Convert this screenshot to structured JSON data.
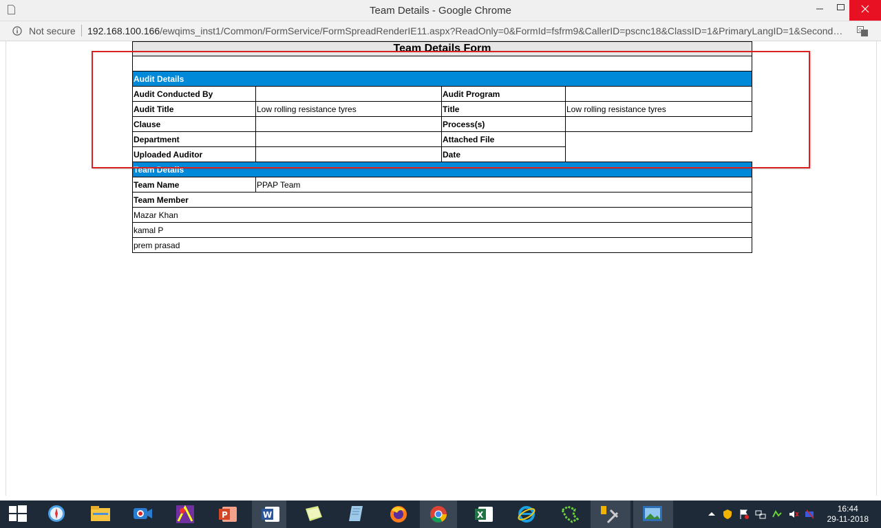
{
  "window": {
    "title": "Team Details - Google Chrome"
  },
  "address": {
    "security": "Not secure",
    "host": "192.168.100.166",
    "path": "/ewqims_inst1/Common/FormService/FormSpreadRenderIE11.aspx?ReadOnly=0&FormId=fsfrm9&CallerID=pscnc18&ClassID=1&PrimaryLangID=1&SecondaryL..."
  },
  "form": {
    "title": "Team Details Form",
    "audit_header": "Audit Details",
    "labels": {
      "conducted_by": "Audit Conducted By",
      "program": "Audit Program",
      "audit_title": "Audit Title",
      "title": "Title",
      "clause": "Clause",
      "processes": "Process(s)",
      "department": "Department",
      "attached_file": "Attached File",
      "uploaded_auditor": "Uploaded Auditor",
      "date": "Date"
    },
    "values": {
      "conducted_by": "",
      "program": "",
      "audit_title": "Low rolling resistance tyres",
      "title": "Low rolling resistance tyres",
      "clause": "",
      "processes": "",
      "department": "",
      "uploaded_auditor": ""
    },
    "team_header": "Team Details",
    "team_name_label": "Team Name",
    "team_name_value": "PPAP Team",
    "team_member_label": "Team Member",
    "members": [
      "Mazar Khan",
      "kamal P",
      "prem prasad"
    ]
  },
  "taskbar": {
    "time": "16:44",
    "date": "29-11-2018",
    "apps": [
      "start-icon",
      "safari-icon",
      "file-explorer-icon",
      "camera-app-icon",
      "paint-app-icon",
      "powerpoint-icon",
      "word-icon",
      "sticky-notes-icon",
      "notepad-icon",
      "firefox-icon",
      "chrome-icon",
      "excel-icon",
      "internet-explorer-icon",
      "green-app-icon",
      "tools-app-icon",
      "photos-app-icon"
    ]
  }
}
